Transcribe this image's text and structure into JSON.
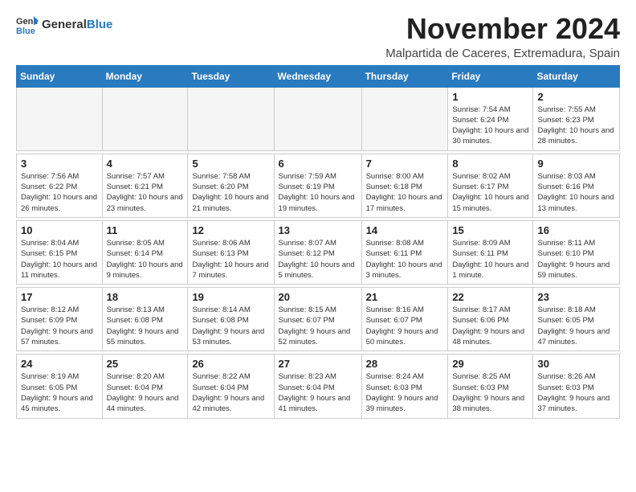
{
  "header": {
    "logo_general": "General",
    "logo_blue": "Blue",
    "title": "November 2024",
    "location": "Malpartida de Caceres, Extremadura, Spain"
  },
  "weekdays": [
    "Sunday",
    "Monday",
    "Tuesday",
    "Wednesday",
    "Thursday",
    "Friday",
    "Saturday"
  ],
  "weeks": [
    [
      {
        "day": "",
        "info": ""
      },
      {
        "day": "",
        "info": ""
      },
      {
        "day": "",
        "info": ""
      },
      {
        "day": "",
        "info": ""
      },
      {
        "day": "",
        "info": ""
      },
      {
        "day": "1",
        "info": "Sunrise: 7:54 AM\nSunset: 6:24 PM\nDaylight: 10 hours and 30 minutes."
      },
      {
        "day": "2",
        "info": "Sunrise: 7:55 AM\nSunset: 6:23 PM\nDaylight: 10 hours and 28 minutes."
      }
    ],
    [
      {
        "day": "3",
        "info": "Sunrise: 7:56 AM\nSunset: 6:22 PM\nDaylight: 10 hours and 26 minutes."
      },
      {
        "day": "4",
        "info": "Sunrise: 7:57 AM\nSunset: 6:21 PM\nDaylight: 10 hours and 23 minutes."
      },
      {
        "day": "5",
        "info": "Sunrise: 7:58 AM\nSunset: 6:20 PM\nDaylight: 10 hours and 21 minutes."
      },
      {
        "day": "6",
        "info": "Sunrise: 7:59 AM\nSunset: 6:19 PM\nDaylight: 10 hours and 19 minutes."
      },
      {
        "day": "7",
        "info": "Sunrise: 8:00 AM\nSunset: 6:18 PM\nDaylight: 10 hours and 17 minutes."
      },
      {
        "day": "8",
        "info": "Sunrise: 8:02 AM\nSunset: 6:17 PM\nDaylight: 10 hours and 15 minutes."
      },
      {
        "day": "9",
        "info": "Sunrise: 8:03 AM\nSunset: 6:16 PM\nDaylight: 10 hours and 13 minutes."
      }
    ],
    [
      {
        "day": "10",
        "info": "Sunrise: 8:04 AM\nSunset: 6:15 PM\nDaylight: 10 hours and 11 minutes."
      },
      {
        "day": "11",
        "info": "Sunrise: 8:05 AM\nSunset: 6:14 PM\nDaylight: 10 hours and 9 minutes."
      },
      {
        "day": "12",
        "info": "Sunrise: 8:06 AM\nSunset: 6:13 PM\nDaylight: 10 hours and 7 minutes."
      },
      {
        "day": "13",
        "info": "Sunrise: 8:07 AM\nSunset: 6:12 PM\nDaylight: 10 hours and 5 minutes."
      },
      {
        "day": "14",
        "info": "Sunrise: 8:08 AM\nSunset: 6:11 PM\nDaylight: 10 hours and 3 minutes."
      },
      {
        "day": "15",
        "info": "Sunrise: 8:09 AM\nSunset: 6:11 PM\nDaylight: 10 hours and 1 minute."
      },
      {
        "day": "16",
        "info": "Sunrise: 8:11 AM\nSunset: 6:10 PM\nDaylight: 9 hours and 59 minutes."
      }
    ],
    [
      {
        "day": "17",
        "info": "Sunrise: 8:12 AM\nSunset: 6:09 PM\nDaylight: 9 hours and 57 minutes."
      },
      {
        "day": "18",
        "info": "Sunrise: 8:13 AM\nSunset: 6:08 PM\nDaylight: 9 hours and 55 minutes."
      },
      {
        "day": "19",
        "info": "Sunrise: 8:14 AM\nSunset: 6:08 PM\nDaylight: 9 hours and 53 minutes."
      },
      {
        "day": "20",
        "info": "Sunrise: 8:15 AM\nSunset: 6:07 PM\nDaylight: 9 hours and 52 minutes."
      },
      {
        "day": "21",
        "info": "Sunrise: 8:16 AM\nSunset: 6:07 PM\nDaylight: 9 hours and 50 minutes."
      },
      {
        "day": "22",
        "info": "Sunrise: 8:17 AM\nSunset: 6:06 PM\nDaylight: 9 hours and 48 minutes."
      },
      {
        "day": "23",
        "info": "Sunrise: 8:18 AM\nSunset: 6:05 PM\nDaylight: 9 hours and 47 minutes."
      }
    ],
    [
      {
        "day": "24",
        "info": "Sunrise: 8:19 AM\nSunset: 6:05 PM\nDaylight: 9 hours and 45 minutes."
      },
      {
        "day": "25",
        "info": "Sunrise: 8:20 AM\nSunset: 6:04 PM\nDaylight: 9 hours and 44 minutes."
      },
      {
        "day": "26",
        "info": "Sunrise: 8:22 AM\nSunset: 6:04 PM\nDaylight: 9 hours and 42 minutes."
      },
      {
        "day": "27",
        "info": "Sunrise: 8:23 AM\nSunset: 6:04 PM\nDaylight: 9 hours and 41 minutes."
      },
      {
        "day": "28",
        "info": "Sunrise: 8:24 AM\nSunset: 6:03 PM\nDaylight: 9 hours and 39 minutes."
      },
      {
        "day": "29",
        "info": "Sunrise: 8:25 AM\nSunset: 6:03 PM\nDaylight: 9 hours and 38 minutes."
      },
      {
        "day": "30",
        "info": "Sunrise: 8:26 AM\nSunset: 6:03 PM\nDaylight: 9 hours and 37 minutes."
      }
    ]
  ]
}
